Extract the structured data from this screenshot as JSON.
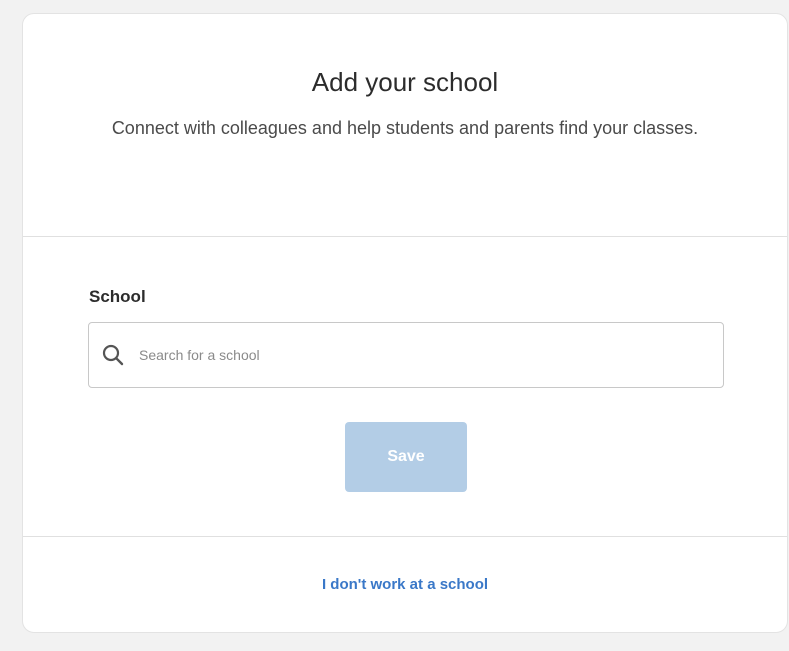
{
  "dialog": {
    "title": "Add your school",
    "subtitle": "Connect with colleagues and help students and parents find your classes."
  },
  "form": {
    "school_label": "School",
    "search": {
      "placeholder": "Search for a school",
      "value": "",
      "icon": "search-icon"
    },
    "save_label": "Save",
    "save_state": "disabled"
  },
  "footer": {
    "link_label": "I don't work at a school"
  },
  "colors": {
    "save_button_disabled": "#b3cde6",
    "link": "#3a78c8",
    "background": "#f2f2f2"
  }
}
